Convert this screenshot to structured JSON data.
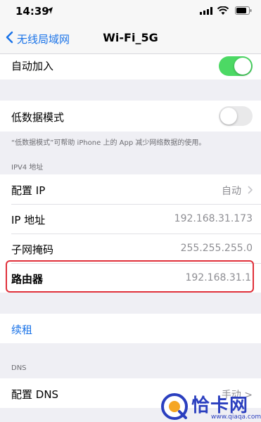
{
  "status_bar": {
    "time": "14:39"
  },
  "nav": {
    "back_label": "无线局域网",
    "title": "Wi-Fi_5G"
  },
  "auto_join": {
    "label": "自动加入",
    "enabled": true
  },
  "low_data": {
    "label": "低数据模式",
    "enabled": false,
    "footer": "“低数据模式”可帮助 iPhone 上的 App 减少网络数据的使用。"
  },
  "ipv4": {
    "header": "IPV4 地址",
    "rows": [
      {
        "label": "配置 IP",
        "value": "自动"
      },
      {
        "label": "IP 地址",
        "value": "192.168.31.173"
      },
      {
        "label": "子网掩码",
        "value": "255.255.255.0"
      },
      {
        "label": "路由器",
        "value": "192.168.31.1"
      }
    ]
  },
  "renew": {
    "label": "续租",
    "color": "#1a73e8"
  },
  "dns": {
    "header": "DNS",
    "row": {
      "label": "配置 DNS",
      "value": "手动 >"
    }
  },
  "watermark": {
    "text": "恰卡网",
    "sub": "www.qiaqa.com"
  },
  "colors": {
    "accent": "#1a73e8",
    "toggle_on": "#4cd964",
    "highlight": "#e0303a"
  }
}
